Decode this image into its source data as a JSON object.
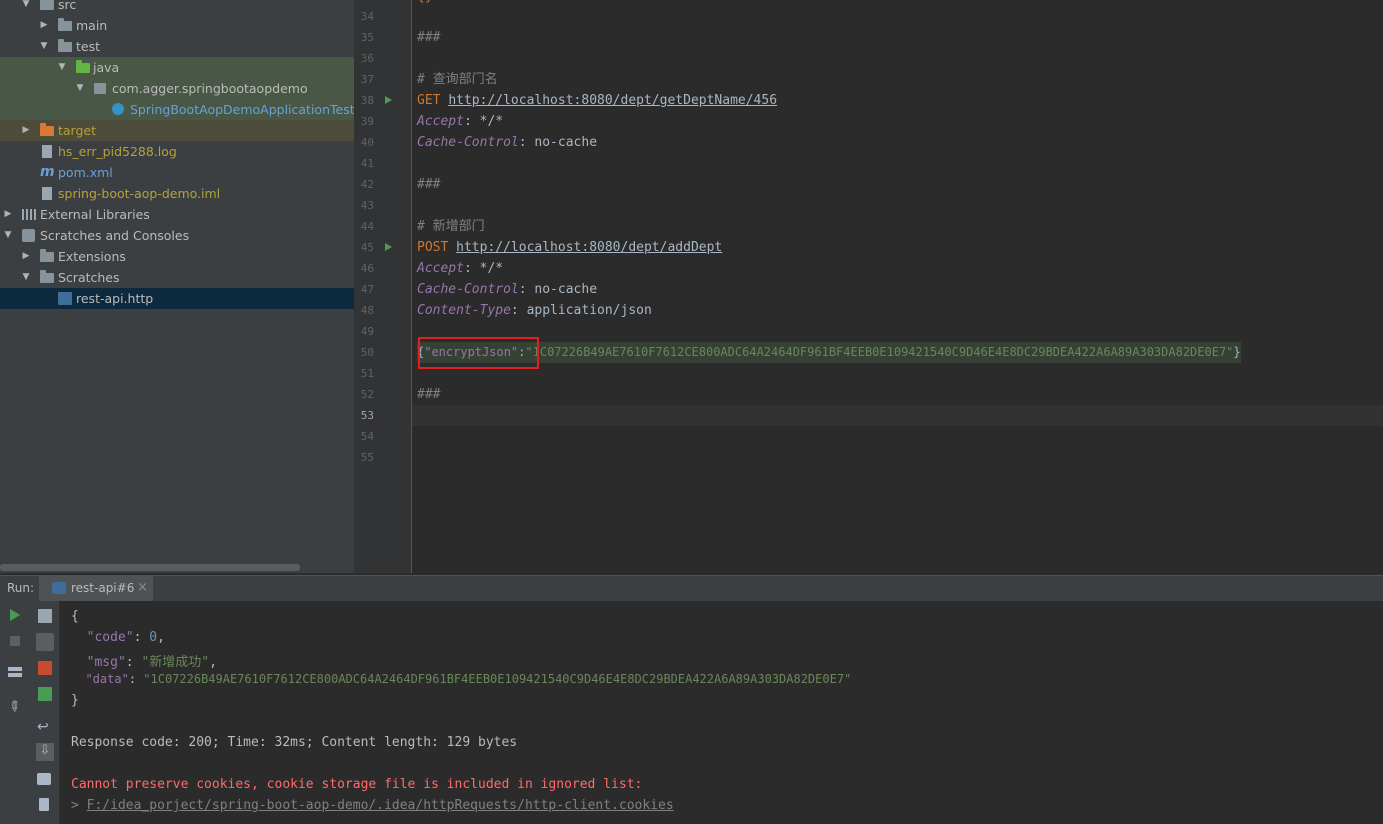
{
  "tree": {
    "items": [
      {
        "label": "src",
        "indent": 1,
        "arrow": "down",
        "icon": "folder"
      },
      {
        "label": "main",
        "indent": 2,
        "arrow": "right",
        "icon": "folder"
      },
      {
        "label": "test",
        "indent": 2,
        "arrow": "down",
        "icon": "folder"
      },
      {
        "label": "java",
        "indent": 3,
        "arrow": "down",
        "icon": "folder-green"
      },
      {
        "label": "com.agger.springbootaopdemo",
        "indent": 4,
        "arrow": "down",
        "icon": "package"
      },
      {
        "label": "SpringBootAopDemoApplicationTests",
        "indent": 5,
        "arrow": "",
        "icon": "class"
      },
      {
        "label": "target",
        "indent": 1,
        "arrow": "right",
        "icon": "folder-orange"
      },
      {
        "label": "hs_err_pid5288.log",
        "indent": 1,
        "arrow": "",
        "icon": "file-log"
      },
      {
        "label": "pom.xml",
        "indent": 1,
        "arrow": "",
        "icon": "maven"
      },
      {
        "label": "spring-boot-aop-demo.iml",
        "indent": 1,
        "arrow": "",
        "icon": "file-iml"
      },
      {
        "label": "External Libraries",
        "indent": 0,
        "arrow": "right",
        "icon": "library"
      },
      {
        "label": "Scratches and Consoles",
        "indent": 0,
        "arrow": "down",
        "icon": "scratch"
      },
      {
        "label": "Extensions",
        "indent": 1,
        "arrow": "right",
        "icon": "folder"
      },
      {
        "label": "Scratches",
        "indent": 1,
        "arrow": "down",
        "icon": "folder"
      },
      {
        "label": "rest-api.http",
        "indent": 2,
        "arrow": "",
        "icon": "api-file"
      }
    ]
  },
  "editor": {
    "line_numbers": [
      "34",
      "35",
      "36",
      "37",
      "38",
      "39",
      "40",
      "41",
      "42",
      "43",
      "44",
      "45",
      "46",
      "47",
      "48",
      "49",
      "50",
      "51",
      "52",
      "53",
      "54",
      "55"
    ],
    "lines": {
      "l35": "###",
      "l37": "# 查询部门名",
      "l38_method": "GET",
      "l38_url": "http://localhost:8080/dept/getDeptName/456",
      "l39_name": "Accept",
      "l39_value": ": */*",
      "l40_name": "Cache-Control",
      "l40_value": ": no-cache",
      "l42": "###",
      "l44": "# 新增部门",
      "l45_method": "POST",
      "l45_url": "http://localhost:8080/dept/addDept",
      "l46_name": "Accept",
      "l46_value": ": */*",
      "l47_name": "Cache-Control",
      "l47_value": ": no-cache",
      "l48_name": "Content-Type",
      "l48_value": ": application/json",
      "l50_open": "{",
      "l50_key": "\"encryptJson\"",
      "l50_colon": ":",
      "l50_value": "\"1C07226B49AE7610F7612CE800ADC64A2464DF961BF4EEB0E109421540C9D46E4E8DC29BDEA422A6A89A303DA82DE0E7\"",
      "l50_close": "}",
      "l52": "###"
    }
  },
  "run": {
    "label": "Run:",
    "tab": "rest-api#6",
    "close": "×"
  },
  "console": {
    "l1": "{",
    "code_key": "\"code\"",
    "code_val": "0",
    "msg_key": "\"msg\"",
    "msg_val": "\"新增成功\"",
    "data_key": "\"data\"",
    "data_val": "\"1C07226B49AE7610F7612CE800ADC64A2464DF961BF4EEB0E109421540C9D46E4E8DC29BDEA422A6A89A303DA82DE0E7\"",
    "l5": "}",
    "response": "Response code: 200; Time: 32ms; Content length: 129 bytes",
    "error": "Cannot preserve cookies, cookie storage file is included in ignored list:",
    "path_prefix": "> ",
    "path": "F:/idea_porject/spring-boot-aop-demo/.idea/httpRequests/http-client.cookies"
  },
  "colors": {
    "accent_run": "#499c54",
    "error": "#ff6b68",
    "highlight_box": "#e02020"
  }
}
